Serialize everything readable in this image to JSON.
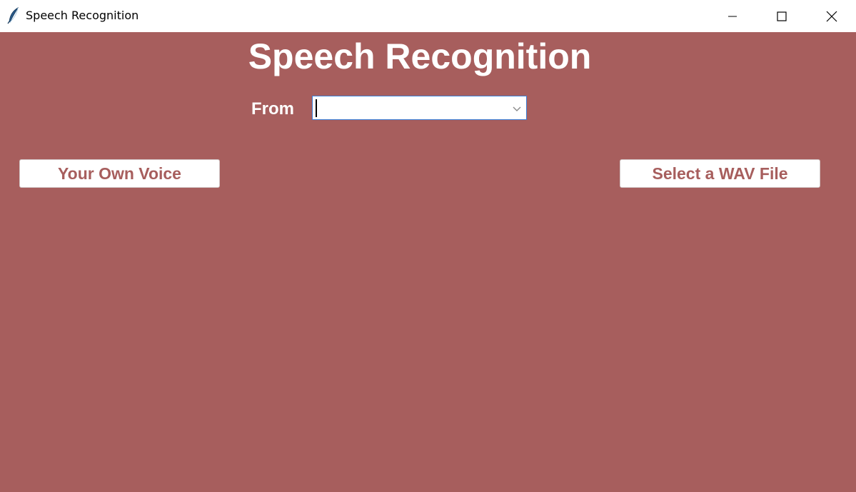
{
  "window": {
    "title": "Speech Recognition",
    "background_color": "#a75e5d",
    "icons": {
      "app": "feather-icon",
      "minimize": "minimize-icon",
      "maximize": "maximize-icon",
      "close": "close-icon"
    }
  },
  "main": {
    "heading": "Speech Recognition",
    "from_label": "From",
    "from_select": {
      "value": "",
      "placeholder": ""
    },
    "buttons": {
      "own_voice": "Your Own Voice",
      "wav_file": "Select a WAV File"
    }
  }
}
